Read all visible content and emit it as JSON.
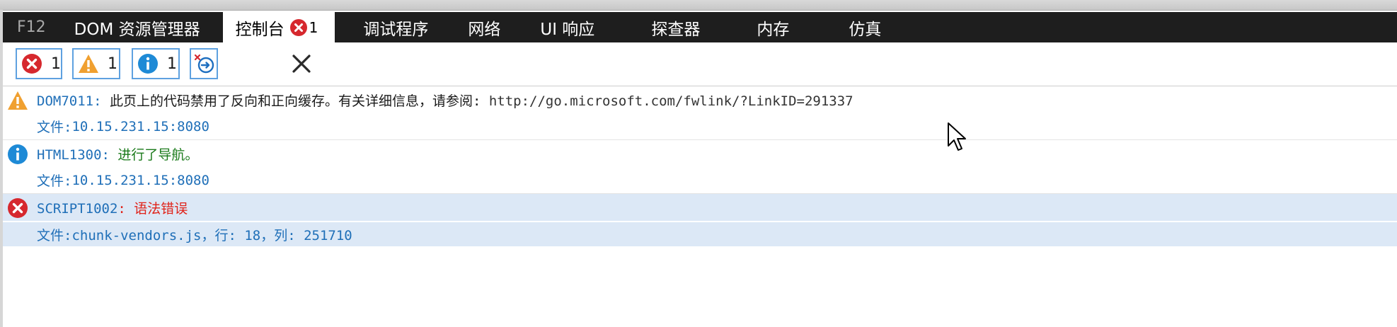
{
  "tabs": {
    "f12": "F12",
    "dom": "DOM 资源管理器",
    "console": "控制台",
    "console_badge_count": "1",
    "debugger": "调试程序",
    "network": "网络",
    "ui": "UI 响应",
    "profiler": "探查器",
    "memory": "内存",
    "emulation": "仿真"
  },
  "toolbar": {
    "errors_count": "1",
    "warnings_count": "1",
    "info_count": "1"
  },
  "messages": [
    {
      "level": "warning",
      "code": "DOM7011",
      "separator": ": ",
      "text": "此页上的代码禁用了反向和正向缓存。有关详细信息，请参阅: ",
      "url": "http://go.microsoft.com/fwlink/?LinkID=291337",
      "file_label": "文件: ",
      "file": "10.15.231.15:8080"
    },
    {
      "level": "info",
      "code": "HTML1300",
      "separator": ": ",
      "text": "进行了导航。",
      "file_label": "文件: ",
      "file": "10.15.231.15:8080"
    },
    {
      "level": "error",
      "code": "SCRIPT1002",
      "separator": ": ",
      "text": "语法错误",
      "file_label": "文件: ",
      "file": "chunk-vendors.js，行: 18，列: 251710"
    }
  ],
  "colors": {
    "tabbar_bg": "#1e1e1e",
    "error": "#d6282e",
    "warning": "#f0a030",
    "info": "#1e8ad6",
    "code_blue": "#1f6fb8",
    "info_green": "#1a7a1a",
    "error_red": "#e0231a",
    "selected_bg": "#dce8f6"
  }
}
